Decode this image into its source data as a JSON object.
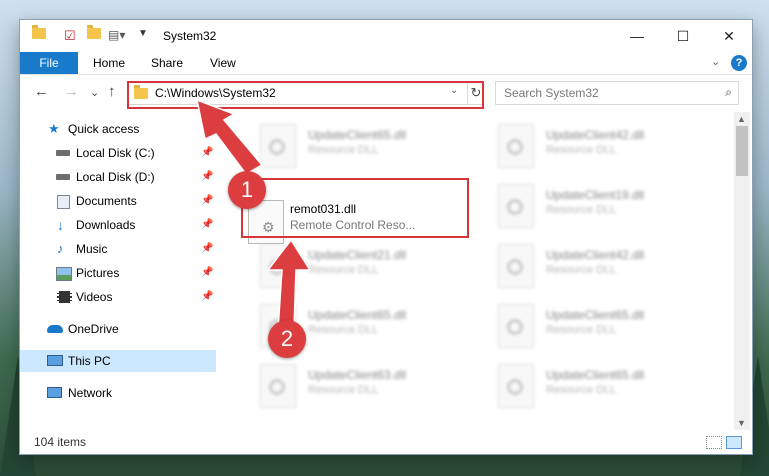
{
  "window": {
    "title": "System32",
    "controls": {
      "minimize": "—",
      "maximize": "☐",
      "close": "✕"
    }
  },
  "ribbon": {
    "tabs": [
      "File",
      "Home",
      "Share",
      "View"
    ],
    "collapse_glyph": "⌄",
    "help_glyph": "?"
  },
  "nav": {
    "back": "←",
    "forward": "→",
    "recent": "⌄",
    "up": "↑",
    "address": "C:\\Windows\\System32",
    "address_dropdown": "⌄",
    "refresh": "↻",
    "search_placeholder": "Search System32",
    "search_icon": "⌕"
  },
  "sidebar": {
    "items": [
      {
        "label": "Quick access",
        "icon": "star-icon",
        "pinned": false
      },
      {
        "label": "Local Disk (C:)",
        "icon": "drive-icon",
        "pinned": true
      },
      {
        "label": "Local Disk (D:)",
        "icon": "drive-icon",
        "pinned": true
      },
      {
        "label": "Documents",
        "icon": "documents-icon",
        "pinned": true
      },
      {
        "label": "Downloads",
        "icon": "downloads-icon",
        "pinned": true
      },
      {
        "label": "Music",
        "icon": "music-icon",
        "pinned": true
      },
      {
        "label": "Pictures",
        "icon": "pictures-icon",
        "pinned": true
      },
      {
        "label": "Videos",
        "icon": "videos-icon",
        "pinned": true
      },
      {
        "label": "OneDrive",
        "icon": "cloud-icon",
        "pinned": false
      },
      {
        "label": "This PC",
        "icon": "pc-icon",
        "pinned": false,
        "selected": true
      },
      {
        "label": "Network",
        "icon": "network-icon",
        "pinned": false
      }
    ],
    "pin_glyph": "📌"
  },
  "files": {
    "highlighted": {
      "name": "remot031.dll",
      "type": "Remote Control Reso..."
    },
    "blurred": [
      {
        "name": "UpdateClient65.dll",
        "type": "Resource DLL"
      },
      {
        "name": "UpdateClient42.dll",
        "type": "Resource DLL"
      },
      {
        "name": "UpdateClient19.dll",
        "type": "Resource DLL"
      },
      {
        "name": "UpdateClient21.dll",
        "type": "Resource DLL"
      },
      {
        "name": "UpdateClient42.dll",
        "type": "Resource DLL"
      },
      {
        "name": "UpdateClient65.dll",
        "type": "Resource DLL"
      },
      {
        "name": "UpdateClient65.dll",
        "type": "Resource DLL"
      },
      {
        "name": "UpdateClient63.dll",
        "type": "Resource DLL"
      },
      {
        "name": "UpdateClient65.dll",
        "type": "Resource DLL"
      }
    ]
  },
  "status": {
    "item_count": "104 items"
  },
  "annotations": {
    "badge1": "1",
    "badge2": "2",
    "color": "#dc3d3f"
  },
  "colors": {
    "accent": "#1979ca",
    "selected": "#cce8ff",
    "annotation": "#d9343a"
  }
}
